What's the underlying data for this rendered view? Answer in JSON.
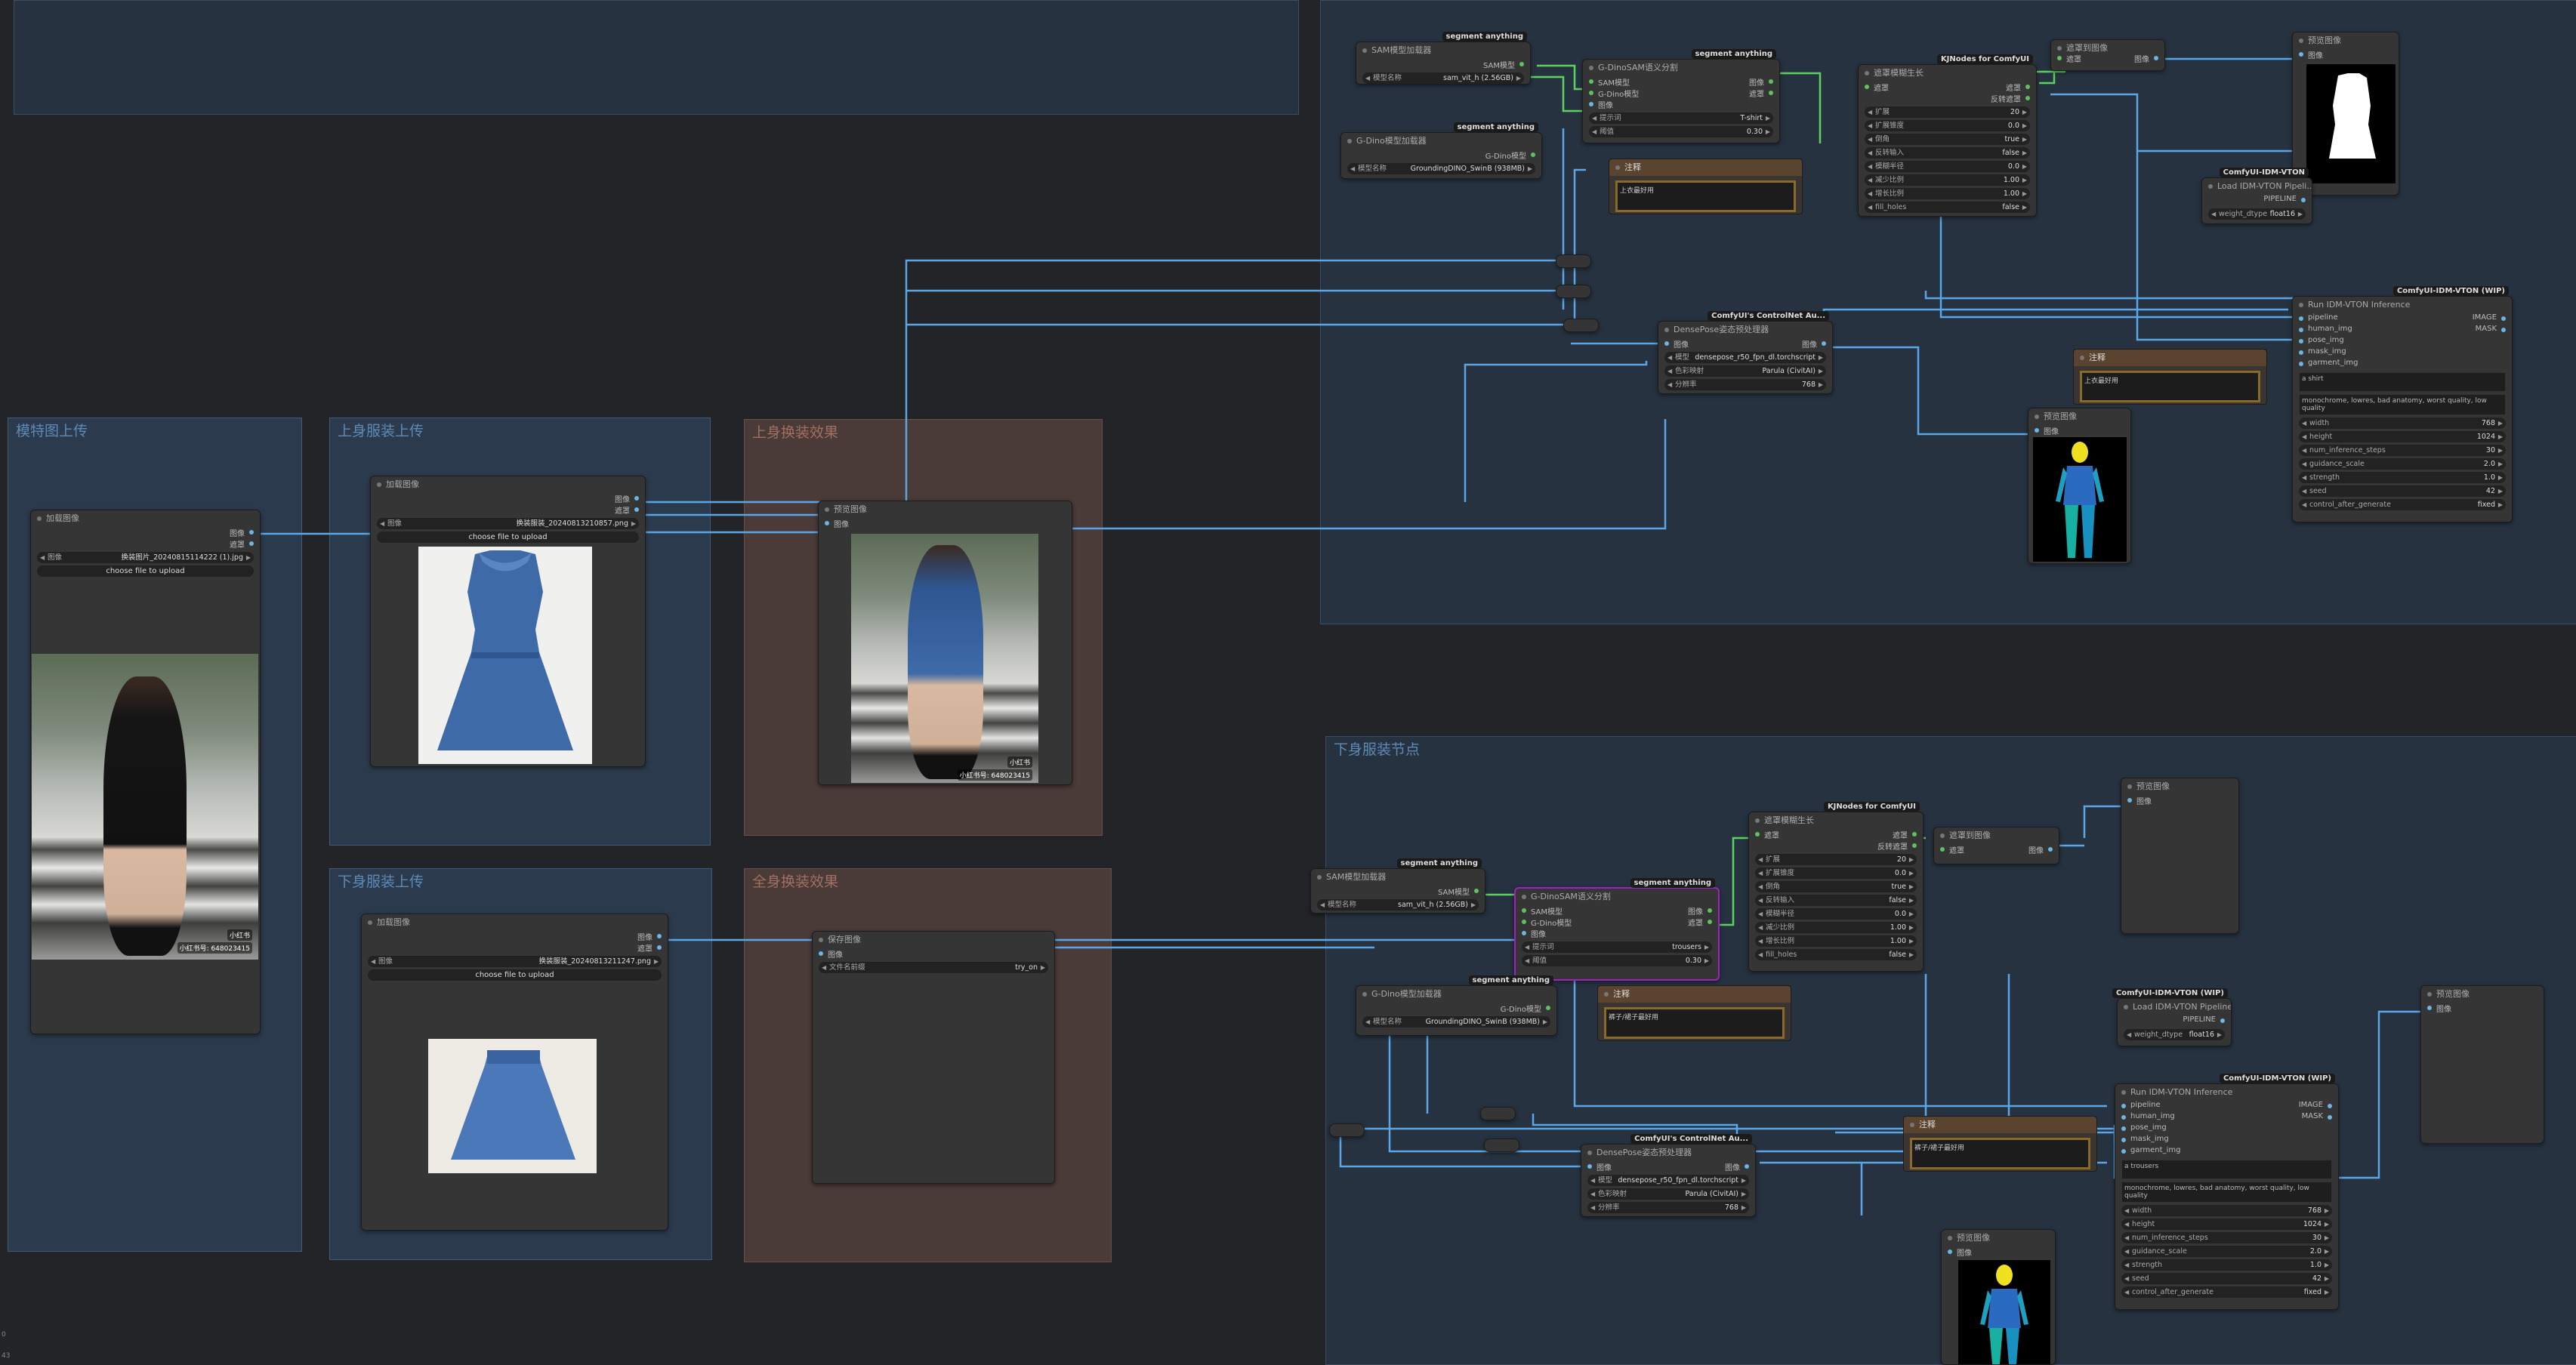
{
  "groups": {
    "model_upload": "模特图上传",
    "top_upload": "上身服装上传",
    "top_result": "上身换装效果",
    "bottom_upload": "下身服装上传",
    "full_result": "全身换装效果",
    "bottom_nodes": "下身服装节点"
  },
  "common": {
    "load_image": "加载图像",
    "preview_image": "预览图像",
    "image_out": "图像",
    "mask_out": "遮罩",
    "image_in": "图像",
    "image_label": "图像",
    "choose_file": "choose file to upload",
    "note": "注释"
  },
  "model_load": {
    "file": "换装图片_20240815114222 (1).jpg"
  },
  "top_load": {
    "file": "换装服装_20240813210857.png"
  },
  "bottom_load": {
    "file": "换装服装_20240813211247.png"
  },
  "save_node": {
    "title": "保存图像",
    "prefix_label": "文件名前缀",
    "prefix_value": "try_on"
  },
  "photo_tags": {
    "model_a": "小红书",
    "model_b": "小红书号: 648023415",
    "result_a": "小红书",
    "result_b": "小红书号: 648023415"
  },
  "top_pipeline": {
    "sam_loader": {
      "title": "SAM模型加载器",
      "badge": "segment anything",
      "out": "SAM模型",
      "w_label": "模型名称",
      "w_value": "sam_vit_h (2.56GB)"
    },
    "dino_loader": {
      "title": "G-Dino模型加载器",
      "badge": "segment anything",
      "out": "G-Dino模型",
      "w_label": "模型名称",
      "w_value": "GroundingDINO_SwinB (938MB)"
    },
    "sam_segment": {
      "title": "G-DinoSAM语义分割",
      "badge": "segment anything",
      "in1": "SAM模型",
      "in2": "G-Dino模型",
      "in3": "图像",
      "out1": "图像",
      "out2": "遮罩",
      "prompt_label": "提示词",
      "prompt_value": "T-shirt",
      "th_label": "阈值",
      "th_value": "0.30"
    },
    "mask_grow": {
      "title": "遮罩模糊生长",
      "badge": "KJNodes for ComfyUI",
      "in": "遮罩",
      "out1": "遮罩",
      "out2": "反转遮罩",
      "rows": [
        [
          "扩展",
          "20"
        ],
        [
          "扩展锥度",
          "0.0"
        ],
        [
          "倒角",
          "true"
        ],
        [
          "反转输入",
          "false"
        ],
        [
          "模糊半径",
          "0.0"
        ],
        [
          "减少比例",
          "1.00"
        ],
        [
          "增长比例",
          "1.00"
        ],
        [
          "fill_holes",
          "false"
        ]
      ]
    },
    "mask_to_image": {
      "title": "遮罩到图像",
      "in": "遮罩",
      "out": "图像"
    },
    "preview_mask": {
      "title": "预览图像"
    },
    "idm_loader": {
      "title": "Load IDM-VTON Pipeli...",
      "badge": "ComfyUI-IDM-VTON",
      "out": "PIPELINE",
      "w_label": "weight_dtype",
      "w_value": "float16"
    },
    "dense": {
      "title": "DensePose姿态预处理器",
      "badge": "ComfyUI's ControlNet Au...",
      "in": "图像",
      "out": "图像",
      "rows": [
        [
          "模型",
          "densepose_r50_fpn_dl.torchscript"
        ],
        [
          "色彩映射",
          "Parula (CivitAI)"
        ],
        [
          "分辨率",
          "768"
        ]
      ]
    },
    "note_a": {
      "text": "上衣最好用"
    },
    "note_b": {
      "text": "上衣最好用"
    },
    "preview_pose": {
      "title": "预览图像"
    },
    "idm_run": {
      "title": "Run IDM-VTON Inference",
      "badge": "ComfyUI-IDM-VTON (WIP)",
      "inputs": [
        "pipeline",
        "human_img",
        "pose_img",
        "mask_img",
        "garment_img"
      ],
      "outputs": [
        "IMAGE",
        "MASK"
      ],
      "prompt": "a shirt",
      "negative": "monochrome, lowres, bad anatomy, worst quality, low quality",
      "rows": [
        [
          "width",
          "768"
        ],
        [
          "height",
          "1024"
        ],
        [
          "num_inference_steps",
          "30"
        ],
        [
          "guidance_scale",
          "2.0"
        ],
        [
          "strength",
          "1.0"
        ],
        [
          "seed",
          "42"
        ],
        [
          "control_after_generate",
          "fixed"
        ]
      ]
    }
  },
  "bottom_pipeline": {
    "sam_loader": {
      "title": "SAM模型加载器",
      "badge": "segment anything",
      "out": "SAM模型",
      "w_label": "模型名称",
      "w_value": "sam_vit_h (2.56GB)"
    },
    "dino_loader": {
      "title": "G-Dino模型加载器",
      "badge": "segment anything",
      "out": "G-Dino模型",
      "w_label": "模型名称",
      "w_value": "GroundingDINO_SwinB (938MB)"
    },
    "sam_segment": {
      "title": "G-DinoSAM语义分割",
      "badge": "segment anything",
      "in1": "SAM模型",
      "in2": "G-Dino模型",
      "in3": "图像",
      "out1": "图像",
      "out2": "遮罩",
      "prompt_label": "提示词",
      "prompt_value": "trousers",
      "th_label": "阈值",
      "th_value": "0.30"
    },
    "mask_grow": {
      "title": "遮罩模糊生长",
      "badge": "KJNodes for ComfyUI",
      "in": "遮罩",
      "out1": "遮罩",
      "out2": "反转遮罩",
      "rows": [
        [
          "扩展",
          "20"
        ],
        [
          "扩展锥度",
          "0.0"
        ],
        [
          "倒角",
          "true"
        ],
        [
          "反转输入",
          "false"
        ],
        [
          "模糊半径",
          "0.0"
        ],
        [
          "减少比例",
          "1.00"
        ],
        [
          "增长比例",
          "1.00"
        ],
        [
          "fill_holes",
          "false"
        ]
      ]
    },
    "mask_to_image": {
      "title": "遮罩到图像",
      "in": "遮罩",
      "out": "图像"
    },
    "preview_mask": {
      "title": "预览图像"
    },
    "idm_loader": {
      "title": "Load IDM-VTON Pipeline",
      "badge": "ComfyUI-IDM-VTON (WIP)",
      "out": "PIPELINE",
      "w_label": "weight_dtype",
      "w_value": "float16"
    },
    "dense": {
      "title": "DensePose姿态预处理器",
      "badge": "ComfyUI's ControlNet Au...",
      "in": "图像",
      "out": "图像",
      "rows": [
        [
          "模型",
          "densepose_r50_fpn_dl.torchscript"
        ],
        [
          "色彩映射",
          "Parula (CivitAI)"
        ],
        [
          "分辨率",
          "768"
        ]
      ]
    },
    "note_a": {
      "text": "裤子/裙子最好用"
    },
    "note_b": {
      "text": "裤子/裙子最好用"
    },
    "preview_pose": {
      "title": "预览图像"
    },
    "preview_out": {
      "title": "预览图像"
    },
    "idm_run": {
      "title": "Run IDM-VTON Inference",
      "badge": "ComfyUI-IDM-VTON (WIP)",
      "inputs": [
        "pipeline",
        "human_img",
        "pose_img",
        "mask_img",
        "garment_img"
      ],
      "outputs": [
        "IMAGE",
        "MASK"
      ],
      "prompt": "a trousers",
      "negative": "monochrome, lowres, bad anatomy, worst quality, low quality",
      "rows": [
        [
          "width",
          "768"
        ],
        [
          "height",
          "1024"
        ],
        [
          "num_inference_steps",
          "30"
        ],
        [
          "guidance_scale",
          "2.0"
        ],
        [
          "strength",
          "1.0"
        ],
        [
          "seed",
          "42"
        ],
        [
          "control_after_generate",
          "fixed"
        ]
      ]
    }
  },
  "corner": {
    "a": "0",
    "b": "43"
  }
}
